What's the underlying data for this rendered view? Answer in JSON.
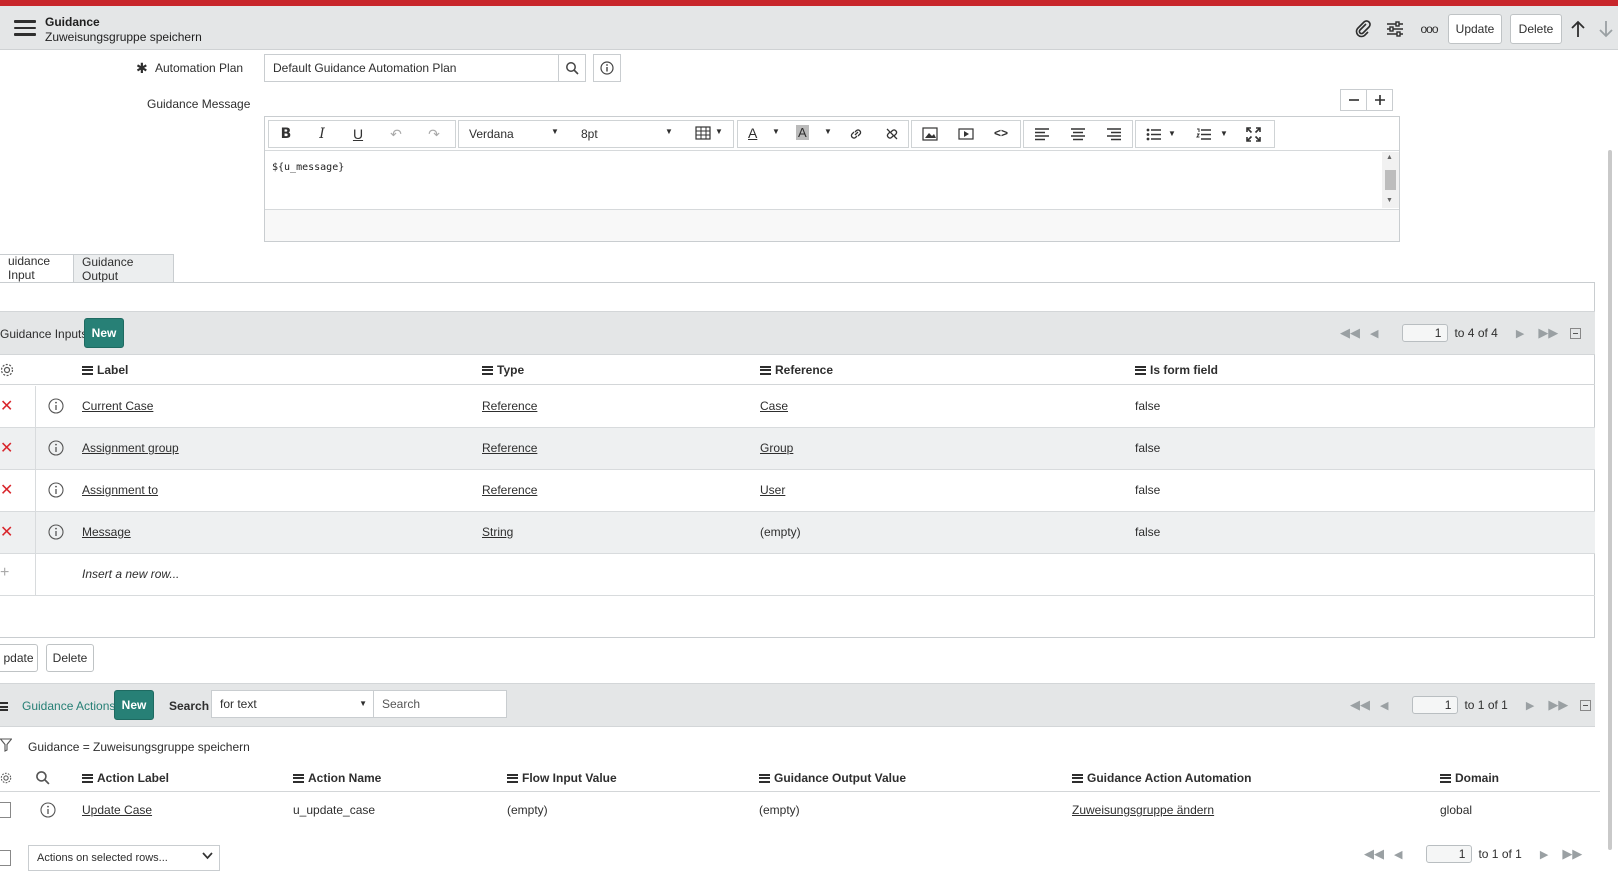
{
  "header": {
    "title": "Guidance",
    "subtitle": "Zuweisungsgruppe speichern",
    "update_label": "Update",
    "delete_label": "Delete",
    "more_label": "ooo"
  },
  "form": {
    "automation_plan_label": "Automation Plan",
    "automation_plan_value": "Default Guidance Automation Plan",
    "guidance_message_label": "Guidance Message",
    "editor": {
      "font": "Verdana",
      "size": "8pt",
      "content": "${u_message}"
    }
  },
  "tabs": [
    {
      "label": "uidance Input"
    },
    {
      "label": "Guidance Output"
    }
  ],
  "inputs_list": {
    "title": "Guidance Inputs",
    "new_label": "New",
    "page": "1",
    "range_text": "to 4 of 4",
    "columns": [
      "Label",
      "Type",
      "Reference",
      "Is form field"
    ],
    "rows": [
      {
        "label": "Current Case",
        "type": "Reference",
        "reference": "Case",
        "form": "false"
      },
      {
        "label": "Assignment group",
        "type": "Reference",
        "reference": "Group",
        "form": "false"
      },
      {
        "label": "Assignment to",
        "type": "Reference",
        "reference": "User",
        "form": "false"
      },
      {
        "label": "Message",
        "type": "String",
        "reference": "(empty)",
        "form": "false"
      }
    ],
    "insert_row": "Insert a new row..."
  },
  "bottom_buttons": {
    "update_label": "pdate",
    "delete_label": "Delete"
  },
  "actions_list": {
    "title": "Guidance Actions",
    "new_label": "New",
    "search_label": "Search",
    "search_select": "for text",
    "search_placeholder": "Search",
    "page": "1",
    "range_text": "to 1 of 1",
    "filter_text": "Guidance = Zuweisungsgruppe speichern",
    "columns": [
      "Action Label",
      "Action Name",
      "Flow Input Value",
      "Guidance Output Value",
      "Guidance Action Automation",
      "Domain"
    ],
    "rows": [
      {
        "label": "Update Case",
        "name": "u_update_case",
        "flow_input": "(empty)",
        "output": "(empty)",
        "automation": "Zuweisungsgruppe ändern",
        "domain": "global"
      }
    ],
    "actions_select": "Actions on selected rows...",
    "footer_page": "1",
    "footer_range": "to 1 of 1"
  },
  "colors": {
    "accent_red": "#c8262b",
    "primary_green": "#278076",
    "delete_red": "#d9262c"
  }
}
